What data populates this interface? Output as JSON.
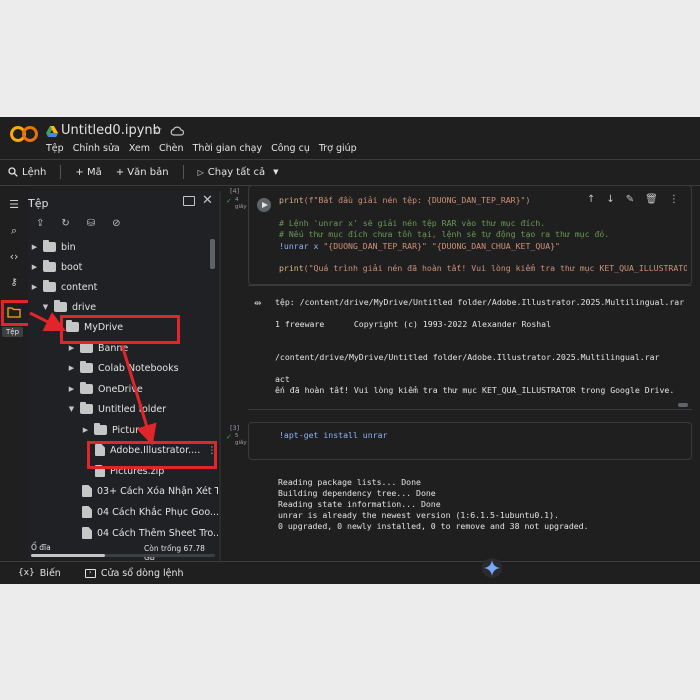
{
  "app": {
    "filename": "Untitled0.ipynb",
    "accent": "#f9ab00"
  },
  "menu": [
    "Tệp",
    "Chỉnh sửa",
    "Xem",
    "Chèn",
    "Thời gian chạy",
    "Công cụ",
    "Trợ giúp"
  ],
  "toolbar": {
    "commands": "Lệnh",
    "add_code": "+ Mã",
    "add_text": "+ Văn bản",
    "run_all": "Chạy tất cả"
  },
  "files_panel": {
    "title": "Tệp",
    "tooltip": "Tệp",
    "tree": [
      {
        "label": "bin",
        "type": "folder",
        "depth": 0
      },
      {
        "label": "boot",
        "type": "folder",
        "depth": 0
      },
      {
        "label": "content",
        "type": "folder",
        "depth": 0
      },
      {
        "label": "drive",
        "type": "folder",
        "depth": 1
      },
      {
        "label": "MyDrive",
        "type": "folder",
        "depth": 2
      },
      {
        "label": "Banne",
        "type": "folder",
        "depth": 3
      },
      {
        "label": "Colab Notebooks",
        "type": "folder",
        "depth": 3
      },
      {
        "label": "OneDrive",
        "type": "folder",
        "depth": 3
      },
      {
        "label": "Untitled folder",
        "type": "folder",
        "depth": 3
      },
      {
        "label": "Pictures",
        "type": "folder",
        "depth": 4
      },
      {
        "label": "Adobe.Illustrator....",
        "type": "file",
        "depth": 4
      },
      {
        "label": "Pictures.zip",
        "type": "file",
        "depth": 4
      },
      {
        "label": "03+ Cách Xóa Nhận Xét T...",
        "type": "file",
        "depth": 3
      },
      {
        "label": "04 Cách Khắc Phục Goo...",
        "type": "file",
        "depth": 3
      },
      {
        "label": "04 Cách Thêm Sheet Tro...",
        "type": "file",
        "depth": 3
      }
    ],
    "disk_label": "Ổ đĩa",
    "disk_free": "Còn trống 67.78 GB",
    "disk_used_fraction": 0.4
  },
  "cells": [
    {
      "exec": "[4]",
      "duration": "4\ngiây",
      "output_lines": [
        "tệp: /content/drive/MyDrive/Untitled folder/Adobe.Illustrator.2025.Multilingual.rar",
        "",
        "1 freeware      Copyright (c) 1993-2022 Alexander Roshal",
        "",
        "",
        "/content/drive/MyDrive/Untitled folder/Adobe.Illustrator.2025.Multilingual.rar",
        "",
        "act",
        "ến đã hoàn tất! Vui lòng kiểm tra thư mục KET_QUA_ILLUSTRATOR trong Google Drive."
      ]
    },
    {
      "exec": "[3]",
      "duration": "5\ngiây",
      "code": "!apt-get install unrar",
      "output_lines": [
        "Reading package lists... Done",
        "Building dependency tree... Done",
        "Reading state information... Done",
        "unrar is already the newest version (1:6.1.5-1ubuntu0.1).",
        "0 upgraded, 0 newly installed, 0 to remove and 38 not upgraded."
      ]
    }
  ],
  "code_cell1": {
    "l1_fn": "print",
    "l1_str": "(f\"Bắt đầu giải nén tệp: {DUONG_DAN_TEP_RAR}\")",
    "l3": "# Lệnh 'unrar x' sẽ giải nén tệp RAR vào thư mục đích.",
    "l4": "# Nếu thư mục đích chưa tồn tại, lệnh sẽ tự động tạo ra thư mục đó.",
    "l5_cmd": "!unrar x ",
    "l5_args": "\"{DUONG_DAN_TEP_RAR}\" \"{DUONG_DAN_CHUA_KET_QUA}\"",
    "l7_fn": "print",
    "l7_str": "(\"Quá trình giải nén đã hoàn tất! Vui lòng kiểm tra thư mục KET_QUA_ILLUSTRATOR"
  },
  "bottom": {
    "variables": "Biến",
    "terminal": "Cửa sổ dòng lệnh"
  }
}
